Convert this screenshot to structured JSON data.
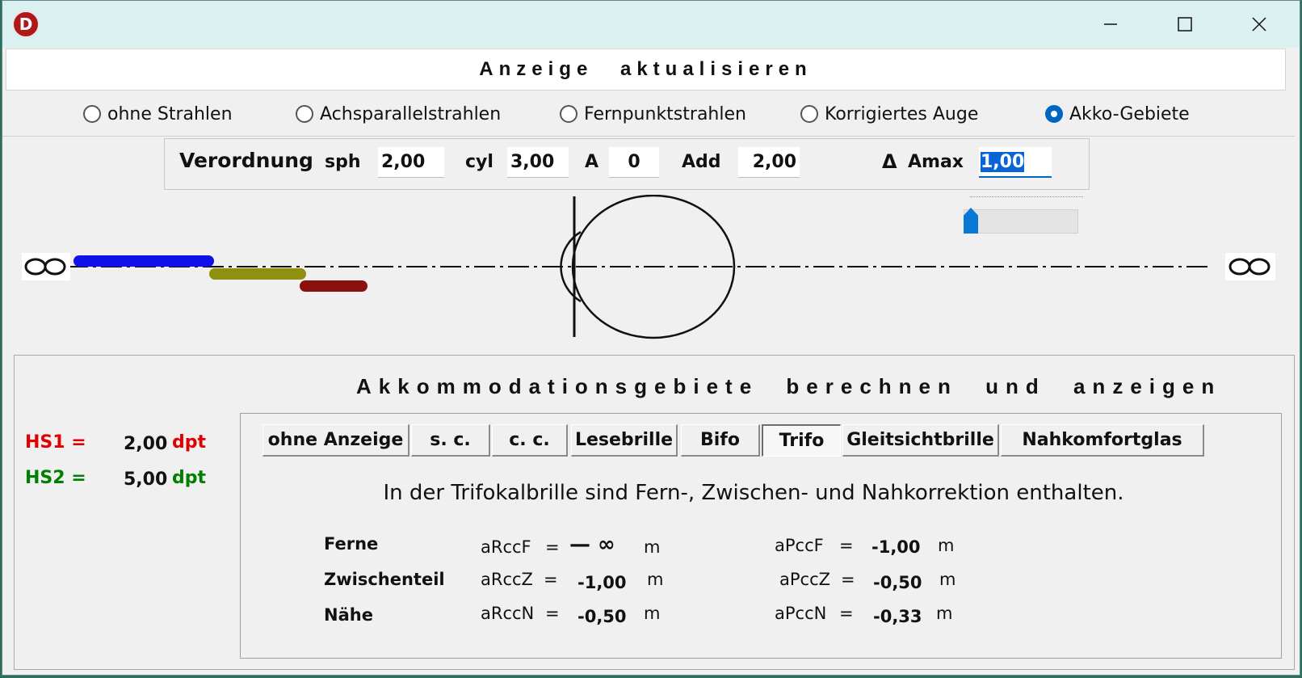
{
  "window": {
    "icon_letter": "D"
  },
  "update_button": "Anzeige aktualisieren",
  "ray_options": [
    {
      "label": "ohne Strahlen",
      "selected": false
    },
    {
      "label": "Achsparallelstrahlen",
      "selected": false
    },
    {
      "label": "Fernpunktstrahlen",
      "selected": false
    },
    {
      "label": "Korrigiertes Auge",
      "selected": false
    },
    {
      "label": "Akko-Gebiete",
      "selected": true
    }
  ],
  "prescription": {
    "title": "Verordnung",
    "sph_label": "sph",
    "sph_value": "2,00",
    "cyl_label": "cyl",
    "cyl_value": "3,00",
    "axis_label": "A",
    "axis_value": "0",
    "add_label": "Add",
    "add_value": "2,00",
    "delta_symbol": "Δ",
    "amax_label": "Amax",
    "amax_value": "1,00"
  },
  "amax_slider": {
    "fraction": 0.0
  },
  "accommodation_ranges": {
    "colors": {
      "far": "#1010e8",
      "intermediate": "#8f8f10",
      "near": "#8b1010"
    }
  },
  "calc": {
    "title": "Akkommodationsgebiete berechnen und anzeigen",
    "hs1_label": "HS1 =",
    "hs1_value": "2,00",
    "hs1_unit": "dpt",
    "hs2_label": "HS2 =",
    "hs2_value": "5,00",
    "hs2_unit": "dpt",
    "hs1_color": "#e00000",
    "hs2_color": "#008000"
  },
  "tabs": [
    {
      "label": "ohne Anzeige",
      "active": false
    },
    {
      "label": "s. c.",
      "active": false
    },
    {
      "label": "c. c.",
      "active": false
    },
    {
      "label": "Lesebrille",
      "active": false
    },
    {
      "label": "Bifo",
      "active": false
    },
    {
      "label": "Trifo",
      "active": true
    },
    {
      "label": "Gleitsichtbrille",
      "active": false
    },
    {
      "label": "Nahkomfortglas",
      "active": false
    }
  ],
  "description": "In der Trifokalbrille sind Fern-, Zwischen- und Nahkorrektion enthalten.",
  "results": {
    "far": {
      "label": "Ferne",
      "r_name": "aRccF",
      "r_eq": "=",
      "r_value": "— ∞",
      "r_unit": "m",
      "p_name": "aPccF",
      "p_eq": "=",
      "p_value": "-1,00",
      "p_unit": "m"
    },
    "intermediate": {
      "label": "Zwischenteil",
      "r_name": "aRccZ",
      "r_eq": "=",
      "r_value": "-1,00",
      "r_unit": "m",
      "p_name": "aPccZ",
      "p_eq": "=",
      "p_value": "-0,50",
      "p_unit": "m"
    },
    "near": {
      "label": "Nähe",
      "r_name": "aRccN",
      "r_eq": "=",
      "r_value": "-0,50",
      "r_unit": "m",
      "p_name": "aPccN",
      "p_eq": "=",
      "p_value": "-0,33",
      "p_unit": "m"
    }
  }
}
